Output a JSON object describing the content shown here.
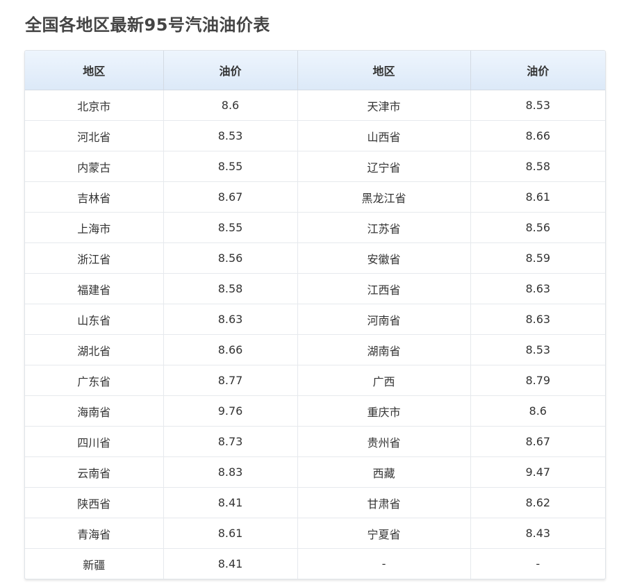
{
  "title": "全国各地区最新95号汽油油价表",
  "table": {
    "headers": [
      "地区",
      "油价",
      "地区",
      "油价"
    ],
    "rows": [
      [
        "北京市",
        "8.6",
        "天津市",
        "8.53"
      ],
      [
        "河北省",
        "8.53",
        "山西省",
        "8.66"
      ],
      [
        "内蒙古",
        "8.55",
        "辽宁省",
        "8.58"
      ],
      [
        "吉林省",
        "8.67",
        "黑龙江省",
        "8.61"
      ],
      [
        "上海市",
        "8.55",
        "江苏省",
        "8.56"
      ],
      [
        "浙江省",
        "8.56",
        "安徽省",
        "8.59"
      ],
      [
        "福建省",
        "8.58",
        "江西省",
        "8.63"
      ],
      [
        "山东省",
        "8.63",
        "河南省",
        "8.63"
      ],
      [
        "湖北省",
        "8.66",
        "湖南省",
        "8.53"
      ],
      [
        "广东省",
        "8.77",
        "广西",
        "8.79"
      ],
      [
        "海南省",
        "9.76",
        "重庆市",
        "8.6"
      ],
      [
        "四川省",
        "8.73",
        "贵州省",
        "8.67"
      ],
      [
        "云南省",
        "8.83",
        "西藏",
        "9.47"
      ],
      [
        "陕西省",
        "8.41",
        "甘肃省",
        "8.62"
      ],
      [
        "青海省",
        "8.61",
        "宁夏省",
        "8.43"
      ],
      [
        "新疆",
        "8.41",
        "-",
        "-"
      ]
    ]
  }
}
